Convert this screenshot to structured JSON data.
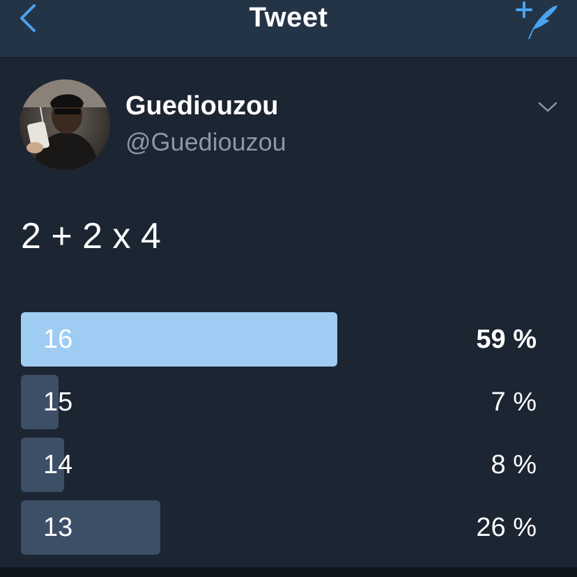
{
  "navbar": {
    "title": "Tweet",
    "back_icon": "chevron-left-icon",
    "compose_icon": "compose-quill-icon",
    "accent": "#4aa3f0"
  },
  "author": {
    "display_name": "Guediouzou",
    "handle": "@Guediouzou",
    "more_icon": "chevron-down-icon"
  },
  "tweet": {
    "text": "2 + 2 x 4"
  },
  "poll": {
    "options": [
      {
        "label": "16",
        "percent_text": "59 %",
        "percent": 59,
        "winner": true
      },
      {
        "label": "15",
        "percent_text": "7 %",
        "percent": 7,
        "winner": false
      },
      {
        "label": "14",
        "percent_text": "8 %",
        "percent": 8,
        "winner": false
      },
      {
        "label": "13",
        "percent_text": "26 %",
        "percent": 26,
        "winner": false
      }
    ],
    "colors": {
      "winner_bar": "#9fccf2",
      "bar": "#3d4f66"
    }
  }
}
